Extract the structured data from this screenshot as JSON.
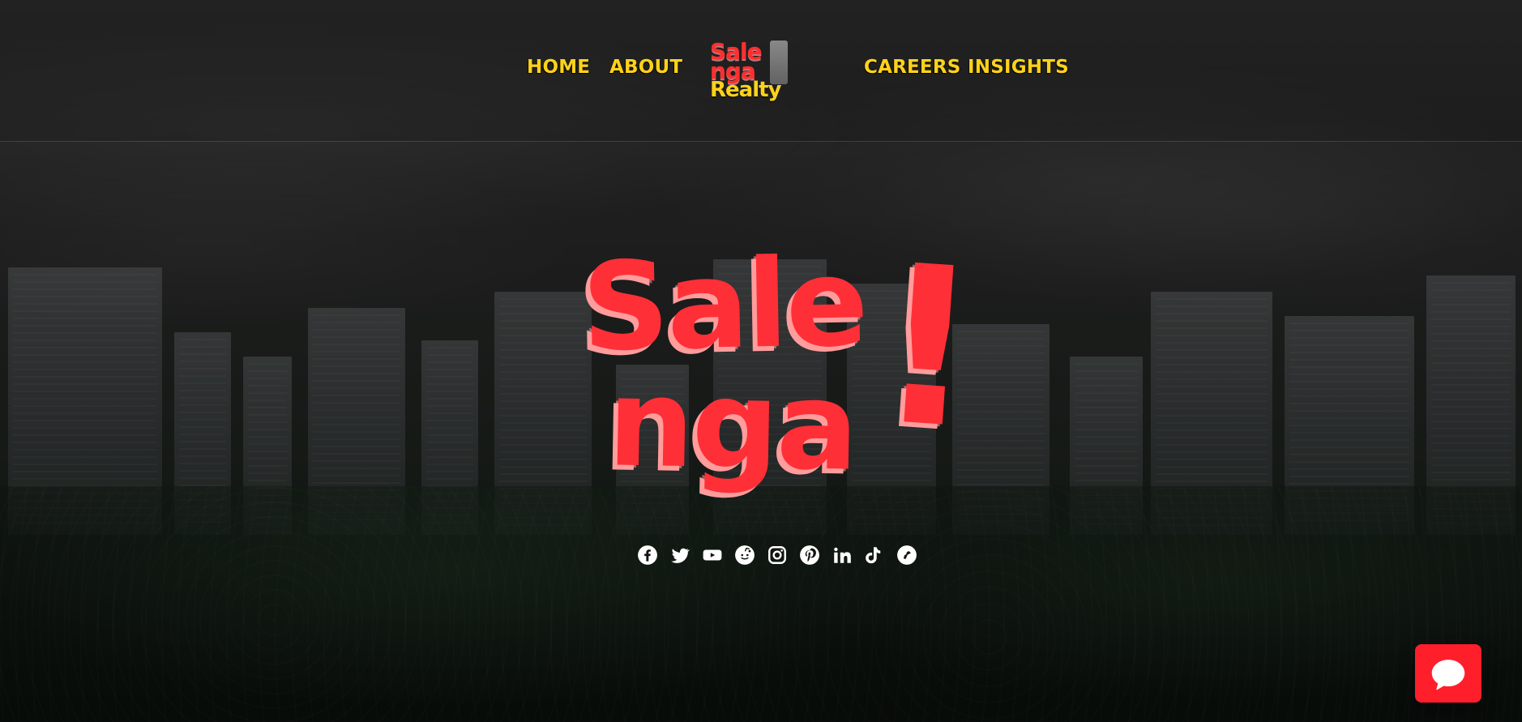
{
  "nav": {
    "home": "HOME",
    "about": "ABOUT",
    "careers": "CAREERS",
    "insights": "INSIGHTS"
  },
  "brand": {
    "lines": [
      "Sale",
      "nga",
      "Realty"
    ]
  },
  "hero": {
    "line1": "Sale",
    "line2": "nga",
    "bang": "!"
  },
  "social": {
    "icons": [
      "facebook-icon",
      "twitter-icon",
      "youtube-icon",
      "reddit-icon",
      "instagram-icon",
      "pinterest-icon",
      "linkedin-icon",
      "tiktok-icon",
      "signal-icon"
    ]
  },
  "colors": {
    "nav_text": "#ffd21a",
    "hero_red": "#ff2f38",
    "hero_shadow": "#ff9c9c",
    "chat_bg": "#ff1f2a",
    "icon_white": "#ffffff"
  }
}
